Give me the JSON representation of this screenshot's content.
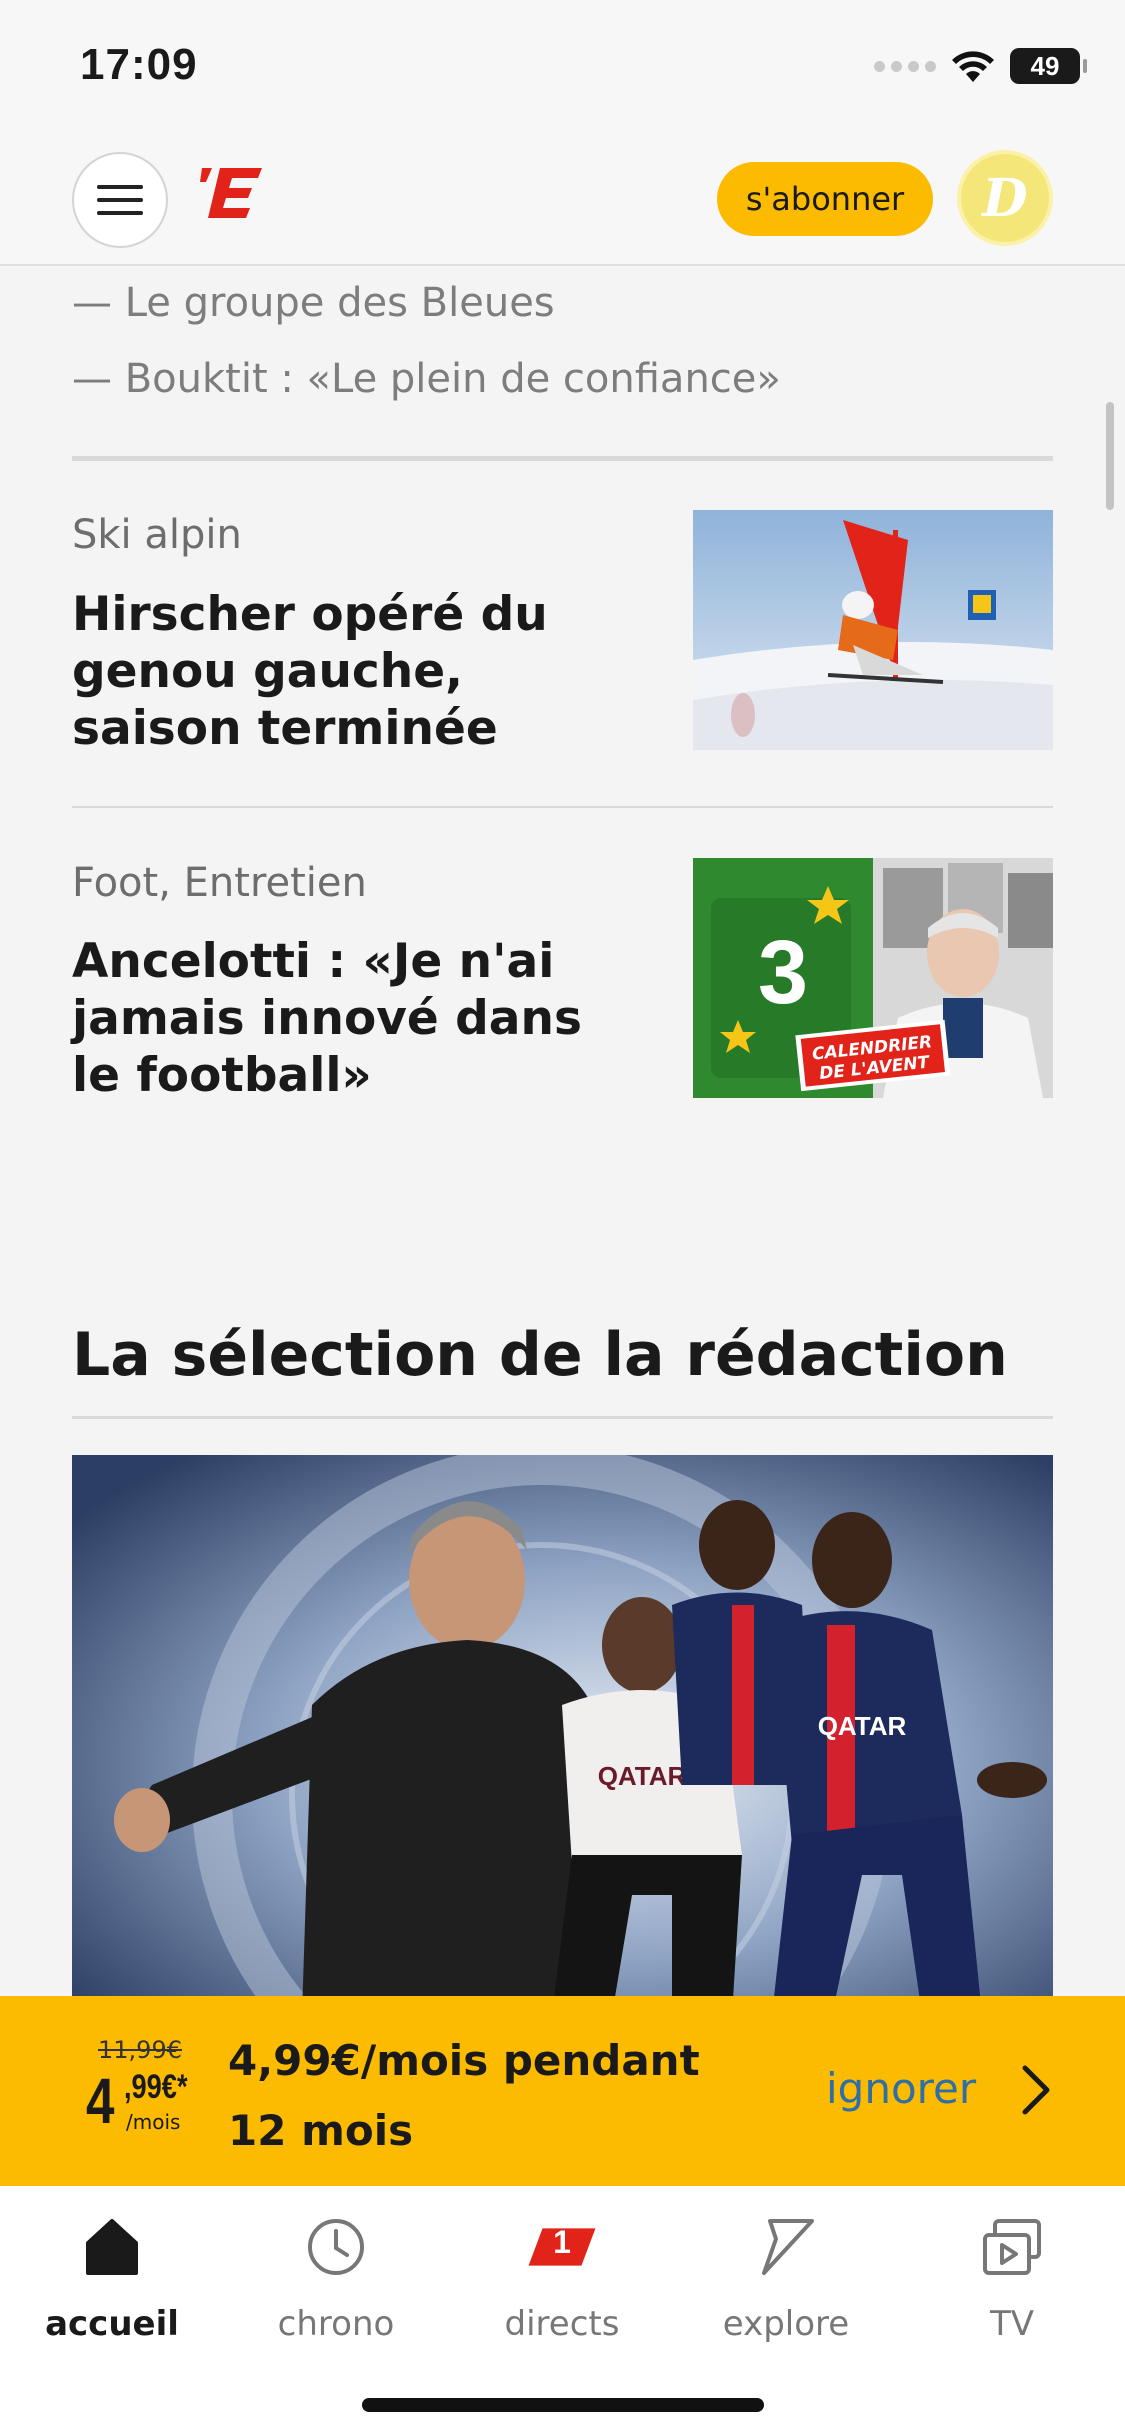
{
  "status_bar": {
    "time": "17:09",
    "battery": "49"
  },
  "header": {
    "logo_text": "’E",
    "subscribe_label": "s'abonner",
    "avatar_letter": "D"
  },
  "related_links": [
    "— Le groupe des Bleues",
    "— Bouktit : «Le plein de confiance»"
  ],
  "articles": [
    {
      "kicker": "Ski alpin",
      "title": "Hirscher opéré du genou gauche, saison terminée"
    },
    {
      "kicker": "Foot, Entretien",
      "title": "Ancelotti : «Je n'ai jamais innové dans le football»",
      "thumb_number": "3",
      "thumb_badge_line1": "CALENDRIER",
      "thumb_badge_line2": "DE L'AVENT"
    }
  ],
  "section": {
    "title": "La sélection de la rédaction"
  },
  "hero": {
    "jersey_text": "QATAR AIRWAYS"
  },
  "promo": {
    "old_price": "11,99€",
    "price_int": "4",
    "price_cents": ",99€*",
    "price_unit": "/mois",
    "text": "4,99€/mois pendant 12 mois",
    "ignore_label": "ignorer"
  },
  "tabs": [
    {
      "label": "accueil",
      "icon": "home-icon"
    },
    {
      "label": "chrono",
      "icon": "clock-icon"
    },
    {
      "label": "directs",
      "icon": "live-badge-icon",
      "badge": "1"
    },
    {
      "label": "explore",
      "icon": "explore-icon"
    },
    {
      "label": "TV",
      "icon": "tv-icon"
    }
  ],
  "colors": {
    "accent": "#fdbb00",
    "brand_red": "#e2231a",
    "link_blue": "#2e6fa8"
  }
}
